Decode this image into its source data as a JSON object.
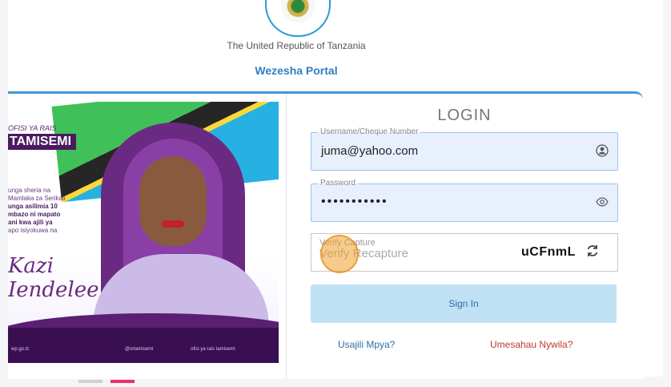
{
  "header": {
    "country": "The United Republic of Tanzania",
    "portal_name": "Wezesha Portal"
  },
  "banner": {
    "office": "OFISI YA RAIS",
    "org": "TAMISEMI",
    "text_lines": [
      "unga sheria na",
      "Mamlaka za Serikali",
      "unga asilimia 10",
      "mbazo ni mapato",
      "ani kwa ajili ya",
      "apo isiyokuwa na"
    ],
    "slogan_line1": "Kazi",
    "slogan_line2": "Iendelee",
    "footer_left": "wp.go.tz",
    "footer_right": "@ortamisemi",
    "footer_far": "ofisi ya rais tamisemi",
    "slides": 2,
    "active_slide": 2
  },
  "form": {
    "title": "LOGIN",
    "username": {
      "label": "Username/Cheque Number",
      "value": "juma@yahoo.com",
      "icon": "user-circle-icon"
    },
    "password": {
      "label": "Password",
      "value": "•••••••••••",
      "icon": "eye-icon"
    },
    "captcha": {
      "label": "Verify Capture",
      "placeholder": "Verify Recapture",
      "code": "uCFnmL",
      "icon": "refresh-icon"
    },
    "submit_label": "Sign In",
    "register_link": "Usajili Mpya?",
    "forgot_link": "Umesahau Nywila?"
  },
  "colors": {
    "accent": "#3d9bd6",
    "portal_title": "#2f7fc0",
    "signin_bg": "#bfe1f3",
    "forgot": "#c0392b",
    "banner_purple": "#5a1f72"
  }
}
